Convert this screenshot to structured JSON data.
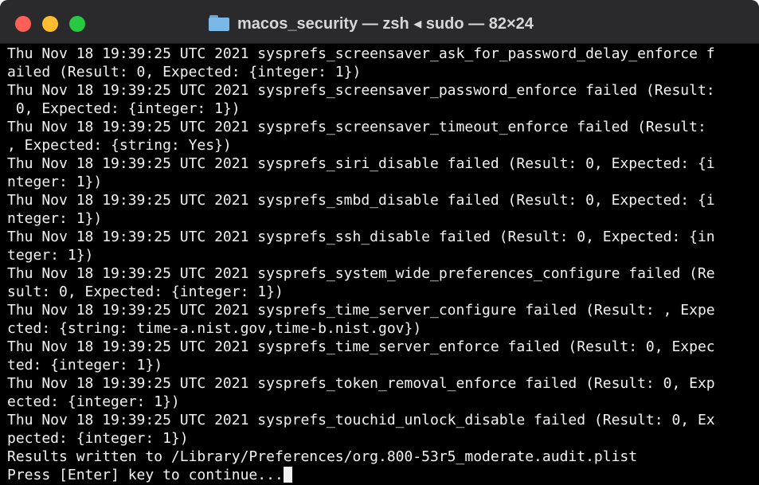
{
  "window": {
    "title": "macos_security — zsh ◂ sudo — 82×24"
  },
  "terminal": {
    "lines": [
      "Thu Nov 18 19:39:25 UTC 2021 sysprefs_screensaver_ask_for_password_delay_enforce f",
      "ailed (Result: 0, Expected: {integer: 1})",
      "Thu Nov 18 19:39:25 UTC 2021 sysprefs_screensaver_password_enforce failed (Result:",
      " 0, Expected: {integer: 1})",
      "Thu Nov 18 19:39:25 UTC 2021 sysprefs_screensaver_timeout_enforce failed (Result: ",
      ", Expected: {string: Yes})",
      "Thu Nov 18 19:39:25 UTC 2021 sysprefs_siri_disable failed (Result: 0, Expected: {i",
      "nteger: 1})",
      "Thu Nov 18 19:39:25 UTC 2021 sysprefs_smbd_disable failed (Result: 0, Expected: {i",
      "nteger: 1})",
      "Thu Nov 18 19:39:25 UTC 2021 sysprefs_ssh_disable failed (Result: 0, Expected: {in",
      "teger: 1})",
      "Thu Nov 18 19:39:25 UTC 2021 sysprefs_system_wide_preferences_configure failed (Re",
      "sult: 0, Expected: {integer: 1})",
      "Thu Nov 18 19:39:25 UTC 2021 sysprefs_time_server_configure failed (Result: , Expe",
      "cted: {string: time-a.nist.gov,time-b.nist.gov})",
      "Thu Nov 18 19:39:25 UTC 2021 sysprefs_time_server_enforce failed (Result: 0, Expec",
      "ted: {integer: 1})",
      "Thu Nov 18 19:39:25 UTC 2021 sysprefs_token_removal_enforce failed (Result: 0, Exp",
      "ected: {integer: 1})",
      "Thu Nov 18 19:39:25 UTC 2021 sysprefs_touchid_unlock_disable failed (Result: 0, Ex",
      "pected: {integer: 1})",
      "Results written to /Library/Preferences/org.800-53r5_moderate.audit.plist"
    ],
    "prompt": "Press [Enter] key to continue..."
  },
  "colors": {
    "titlebar": "#2a2a2c",
    "background": "#000000",
    "text": "#f2f2f2",
    "close": "#ff5f57",
    "minimize": "#febc2e",
    "maximize": "#28c840",
    "folder": "#79b8e6"
  },
  "icons": {
    "title_icon": "folder-icon"
  }
}
